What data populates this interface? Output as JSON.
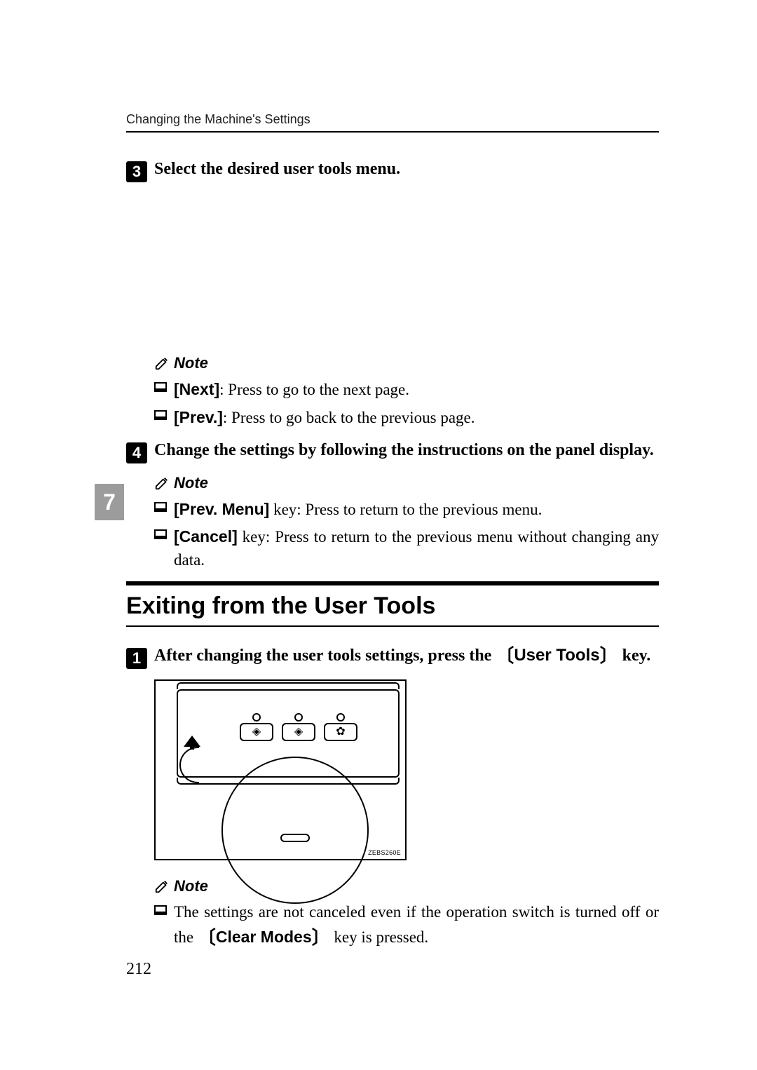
{
  "runningHead": "Changing the Machine's Settings",
  "sideTab": "7",
  "pageNumber": "212",
  "step3": {
    "num": "3",
    "text": "Select the desired user tools menu."
  },
  "note1": {
    "label": "Note",
    "items": [
      {
        "boldKey": "[Next]",
        "rest": ": Press to go to the next page."
      },
      {
        "boldKey": "[Prev.]",
        "rest": ": Press to go back to the previous page."
      }
    ]
  },
  "step4": {
    "num": "4",
    "text": "Change the settings by following the instructions on the panel display."
  },
  "note2": {
    "label": "Note",
    "items": [
      {
        "boldKey": "[Prev. Menu]",
        "rest": " key: Press to return to the previous menu."
      },
      {
        "boldKey": "[Cancel]",
        "rest": " key: Press to return to the previous menu without changing any data."
      }
    ]
  },
  "sectionHeading": "Exiting from the User Tools",
  "step1b": {
    "num": "1",
    "pre": "After changing the user tools settings, press the ",
    "keyLabel": "User Tools",
    "post": " key."
  },
  "figureCode": "ZEBS260E",
  "note3": {
    "label": "Note",
    "items": [
      {
        "pre": "The settings are not canceled even if the operation switch is turned off or the ",
        "keyLabel": "Clear Modes",
        "post": " key is pressed."
      }
    ]
  }
}
